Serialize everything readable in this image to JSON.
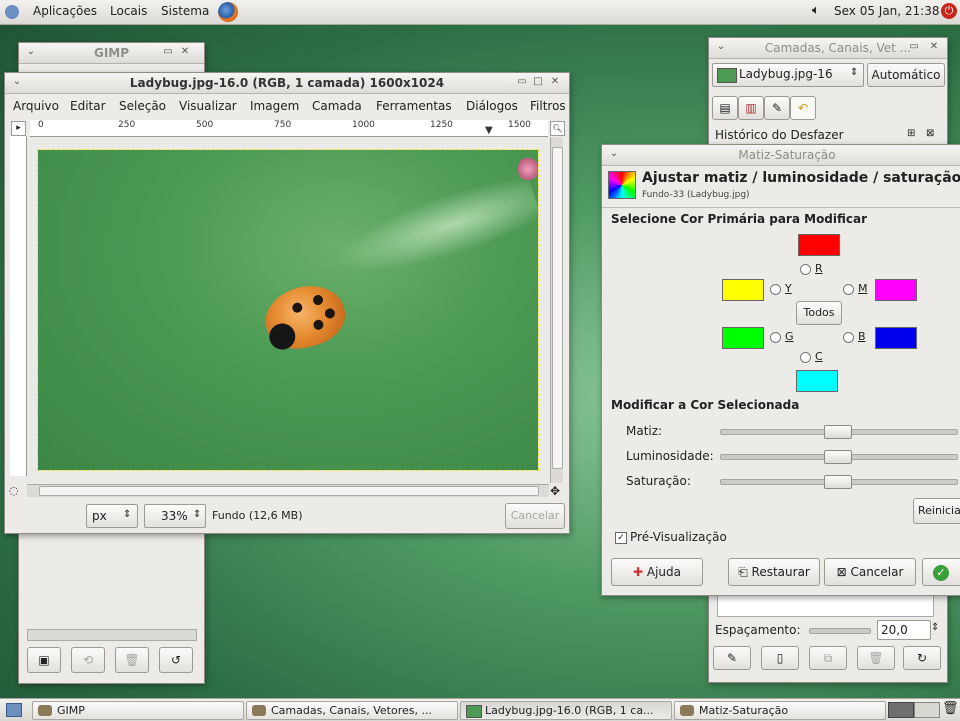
{
  "top_panel": {
    "menus": [
      "Aplicações",
      "Locais",
      "Sistema"
    ],
    "clock": "Sex 05 Jan, 21:38"
  },
  "toolbox": {
    "title": "GIMP"
  },
  "image_window": {
    "title": "Ladybug.jpg-16.0 (RGB, 1 camada) 1600x1024",
    "menu": [
      "Arquivo",
      "Editar",
      "Seleção",
      "Visualizar",
      "Imagem",
      "Camada",
      "Ferramentas",
      "Diálogos",
      "Filtros"
    ],
    "ruler_ticks": [
      "0",
      "250",
      "500",
      "750",
      "1000",
      "1250",
      "1500"
    ],
    "unit": "px",
    "zoom": "33%",
    "status": "Fundo (12,6 MB)",
    "cancel_label": "Cancelar"
  },
  "layers_dock": {
    "title": "Camadas, Canais, Vet ...",
    "image_select": "Ladybug.jpg-16",
    "auto_label": "Automático",
    "undo_history": "Histórico do Desfazer",
    "spacing_label": "Espaçamento:",
    "spacing_value": "20,0"
  },
  "hue_dialog": {
    "window_title": "Matiz-Saturação",
    "heading": "Ajustar matiz / luminosidade / saturação",
    "subheading": "Fundo-33 (Ladybug.jpg)",
    "section_select": "Selecione Cor Primária para Modificar",
    "section_modify": "Modificar a Cor Selecionada",
    "radios": {
      "r": "R",
      "y": "Y",
      "m": "M",
      "g": "G",
      "b": "B",
      "c": "C"
    },
    "all_button": "Todos",
    "swatch_colors": {
      "r": "#ff0000",
      "y": "#ffff00",
      "m": "#ff00ff",
      "g": "#00ff00",
      "b": "#0000ee",
      "c": "#00ffff"
    },
    "sliders": [
      {
        "label": "Matiz:",
        "value": 0
      },
      {
        "label": "Luminosidade:",
        "value": 0
      },
      {
        "label": "Saturação:",
        "value": 0
      }
    ],
    "reset_label": "Reiniciar",
    "preview_label": "Pré-Visualização",
    "preview_checked": true,
    "help_label": "Ajuda",
    "restore_label": "Restaurar",
    "cancel_label": "Cancelar"
  },
  "taskbar": {
    "items": [
      "GIMP",
      "Camadas, Canais, Vetores, ...",
      "Ladybug.jpg-16.0 (RGB, 1 ca...",
      "Matiz-Saturação"
    ]
  }
}
